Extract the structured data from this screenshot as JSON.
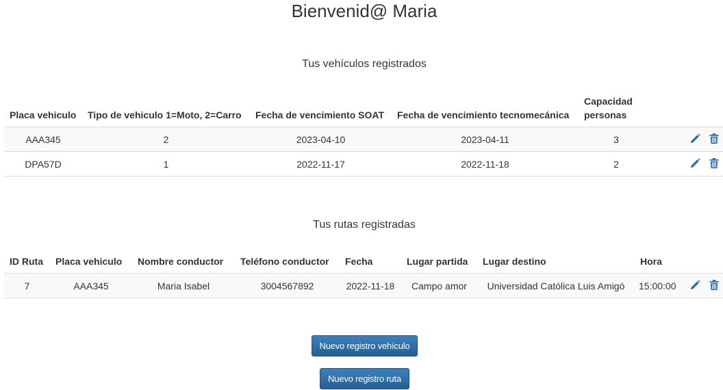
{
  "header": {
    "title": "Bienvenid@ Maria"
  },
  "vehicles": {
    "section_title": "Tus vehículos registrados",
    "columns": [
      "Placa vehiculo",
      "Tipo de vehiculo 1=Moto, 2=Carro",
      "Fecha de vencimiento SOAT",
      "Fecha de vencimiento tecnomecánica",
      "Capacidad personas"
    ],
    "rows": [
      {
        "placa": "AAA345",
        "tipo": "2",
        "soat": "2023-04-10",
        "tecno": "2023-04-11",
        "capacidad": "3"
      },
      {
        "placa": "DPA57D",
        "tipo": "1",
        "soat": "2022-11-17",
        "tecno": "2022-11-18",
        "capacidad": "2"
      }
    ]
  },
  "routes": {
    "section_title": "Tus rutas registradas",
    "columns": [
      "ID Ruta",
      "Placa vehiculo",
      "Nombre conductor",
      "Teléfono conductor",
      "Fecha",
      "Lugar partida",
      "Lugar destino",
      "Hora"
    ],
    "rows": [
      {
        "id": "7",
        "placa": "AAA345",
        "nombre": "Maria Isabel",
        "telefono": "3004567892",
        "fecha": "2022-11-18",
        "partida": "Campo amor",
        "destino": "Universidad Católica Luis Amigó",
        "hora": "15:00:00"
      }
    ]
  },
  "buttons": {
    "new_vehicle": "Nuevo registro vehículo",
    "new_route": "Nuevo registro ruta"
  },
  "icons": {
    "edit": "pencil-icon",
    "delete": "trash-icon"
  },
  "colors": {
    "icon": "#2f6fab",
    "button": "#2d6ca2"
  }
}
